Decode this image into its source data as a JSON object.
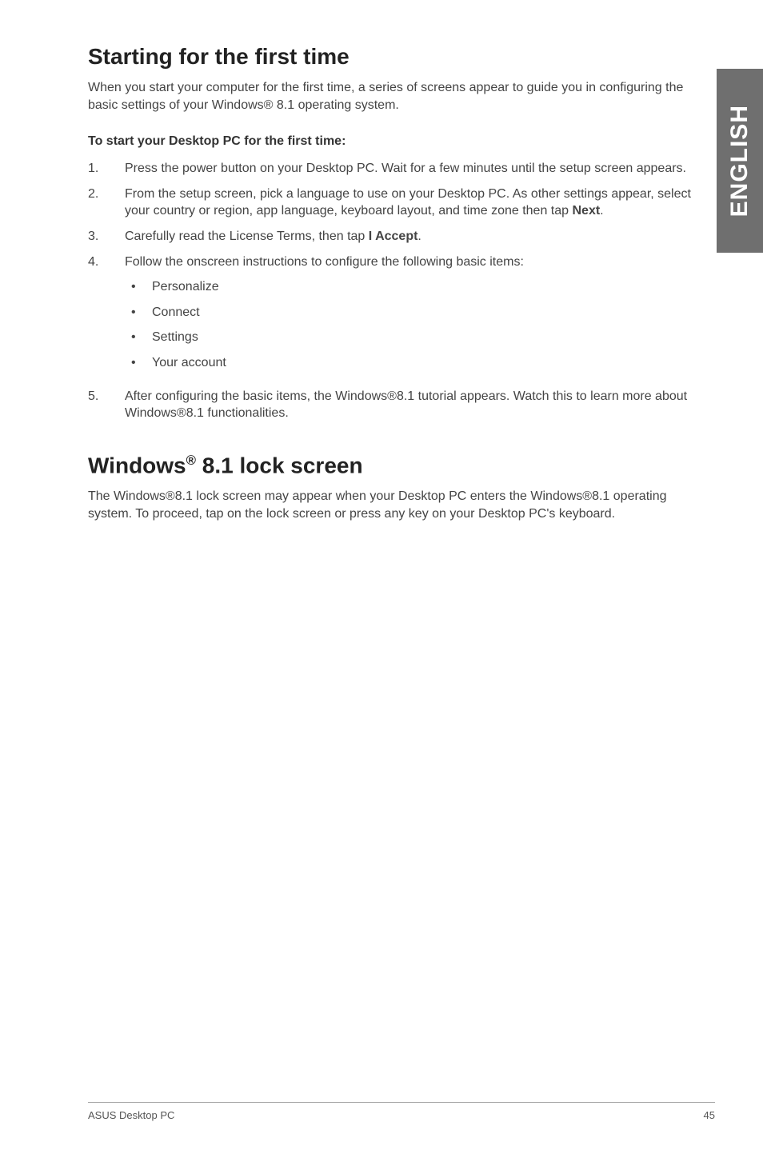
{
  "sideTab": "ENGLISH",
  "section1": {
    "title": "Starting for the first time",
    "intro": "When you start your computer for the first time, a series of screens appear to guide you in configuring the basic settings of your Windows® 8.1 operating system.",
    "subhead": "To start your Desktop PC for the first time:",
    "steps": {
      "s1": "Press the power button on your Desktop PC. Wait for a few minutes until the setup screen appears.",
      "s2a": "From the setup screen, pick a language to use on your Desktop PC. As other settings appear, select your country or region, app language, keyboard layout, and time zone then tap ",
      "s2b": "Next",
      "s2c": ".",
      "s3a": "Carefully read the License Terms, then tap ",
      "s3b": "I Accept",
      "s3c": ".",
      "s4": "Follow the onscreen instructions to configure the following basic items:",
      "sub": {
        "a": "Personalize",
        "b": "Connect",
        "c": "Settings",
        "d": "Your account"
      },
      "s5": "After configuring the basic items, the Windows®8.1 tutorial appears. Watch this to learn more about Windows®8.1 functionalities."
    }
  },
  "section2": {
    "titleA": "Windows",
    "titleSup": "®",
    "titleB": " 8.1 lock screen",
    "intro": "The Windows®8.1 lock screen may appear when your Desktop PC enters the Windows®8.1 operating system. To proceed,  tap on the lock screen or press any key on your Desktop PC's keyboard."
  },
  "footer": {
    "left": "ASUS Desktop PC",
    "right": "45"
  }
}
